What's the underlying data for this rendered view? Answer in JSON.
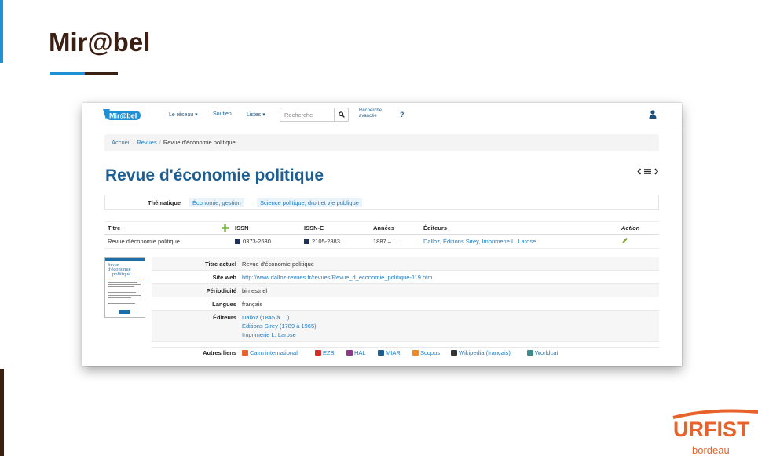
{
  "slide": {
    "title": "Mir@bel",
    "colors": {
      "title": "#3a1f12",
      "accent_blue": "#1e90d6",
      "accent_brown": "#3a1f12",
      "urfist_orange": "#e8632b"
    }
  },
  "navbar": {
    "logo_text": "Mir@bel",
    "items": [
      {
        "label": "Le réseau",
        "dropdown": true
      },
      {
        "label": "Soutien",
        "dropdown": false
      },
      {
        "label": "Listes",
        "dropdown": true
      }
    ],
    "search_placeholder": "Recherche",
    "advanced_search_line1": "Recherche",
    "advanced_search_line2": "avancée",
    "help": "?",
    "icons": {
      "search": "search-icon",
      "user": "user-icon"
    }
  },
  "breadcrumb": {
    "items": [
      "Accueil",
      "Revues"
    ],
    "current": "Revue d'économie politique"
  },
  "page": {
    "title": "Revue d'économie politique",
    "pager_icons": [
      "chevron-left-icon",
      "list-icon",
      "chevron-right-icon"
    ]
  },
  "thematique": {
    "label": "Thématique",
    "tags": [
      "Économie, gestion",
      "Science politique, droit et vie publique"
    ]
  },
  "titles_table": {
    "headers": {
      "titre": "Titre",
      "issn": "ISSN",
      "issne": "ISSN-E",
      "annees": "Années",
      "editeurs": "Éditeurs",
      "action": "Action"
    },
    "rows": [
      {
        "titre": "Revue d'économie politique",
        "issn": "0373-2630",
        "issne": "2105-2883",
        "annees": "1887 – …",
        "editeurs": "Dalloz, Éditions Sirey, Imprimerie L. Larose"
      }
    ]
  },
  "cover": {
    "line1": "Revue",
    "line2": "d'économie",
    "line3": "politique"
  },
  "details": {
    "titre_actuel": {
      "label": "Titre actuel",
      "value": "Revue d'économie politique"
    },
    "site_web": {
      "label": "Site web",
      "value": "http://www.dalloz-revues.fr/revues/Revue_d_economie_politique-119.htm"
    },
    "periodicite": {
      "label": "Périodicité",
      "value": "bimestriel"
    },
    "langues": {
      "label": "Langues",
      "value": "français"
    },
    "editeurs": {
      "label": "Éditeurs",
      "values": [
        "Dalloz (1845 à …)",
        "Éditions Sirey (1789 à 1965)",
        "Imprimerie L. Larose"
      ]
    }
  },
  "autres_liens": {
    "label": "Autres liens",
    "links": [
      {
        "label": "Cairn international",
        "color": "#e8632b"
      },
      {
        "label": "EZB",
        "color": "#d62d2d"
      },
      {
        "label": "HAL",
        "color": "#8b3a8b"
      },
      {
        "label": "MIAR",
        "color": "#1f5e8f"
      },
      {
        "label": "Scopus",
        "color": "#f08a24"
      },
      {
        "label": "Wikipedia (français)",
        "color": "#333333"
      },
      {
        "label": "Worldcat",
        "color": "#3d8a8a"
      }
    ]
  },
  "urfist": {
    "name": "URFIST",
    "city": "bordeau"
  }
}
